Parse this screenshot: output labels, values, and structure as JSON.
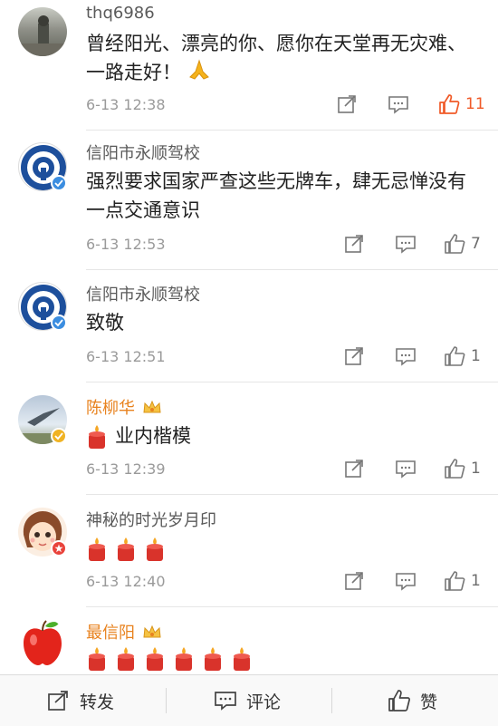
{
  "comments": [
    {
      "user": "thq6986",
      "text": "曾经阳光、漂亮的你、愿你在天堂再无灾难、一路走好！",
      "time": "6-13 12:38",
      "likes": "11"
    },
    {
      "user": "信阳市永顺驾校",
      "text": "强烈要求国家严查这些无牌车，肆无忌惮没有一点交通意识",
      "time": "6-13 12:53",
      "likes": "7"
    },
    {
      "user": "信阳市永顺驾校",
      "text": "致敬",
      "time": "6-13 12:51",
      "likes": "1"
    },
    {
      "user": "陈柳华",
      "text": "业内楷模",
      "time": "6-13 12:39",
      "likes": "1"
    },
    {
      "user": "神秘的时光岁月印",
      "text": "",
      "time": "6-13 12:40",
      "likes": "1"
    },
    {
      "user": "最信阳",
      "text": "",
      "time": "",
      "likes": ""
    }
  ],
  "bottom_bar": {
    "repost": "转发",
    "comment": "评论",
    "like": "赞"
  },
  "colors": {
    "vip_name": "#e8821e",
    "liked": "#f05a28",
    "verified_blue": "#3b8de0",
    "verified_gold": "#f0b323"
  }
}
